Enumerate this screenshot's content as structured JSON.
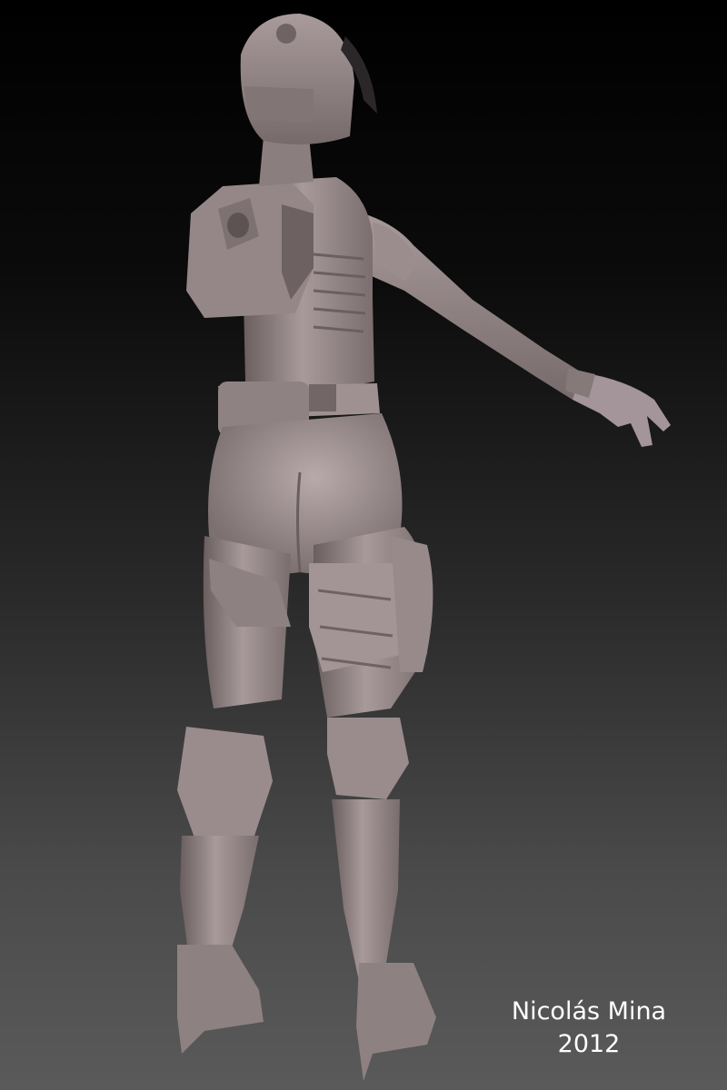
{
  "image": {
    "subject": "3D sculpt render of a female figure in sci-fi armor, seen from behind",
    "colors": {
      "background_top": "#000000",
      "background_bottom": "#5a5a5a",
      "material": "#8f8283",
      "material_light": "#b7a9a9",
      "material_dark": "#5b5051"
    }
  },
  "credit": {
    "author": "Nicolás Mina",
    "year": "2012",
    "color": "#ffffff"
  }
}
